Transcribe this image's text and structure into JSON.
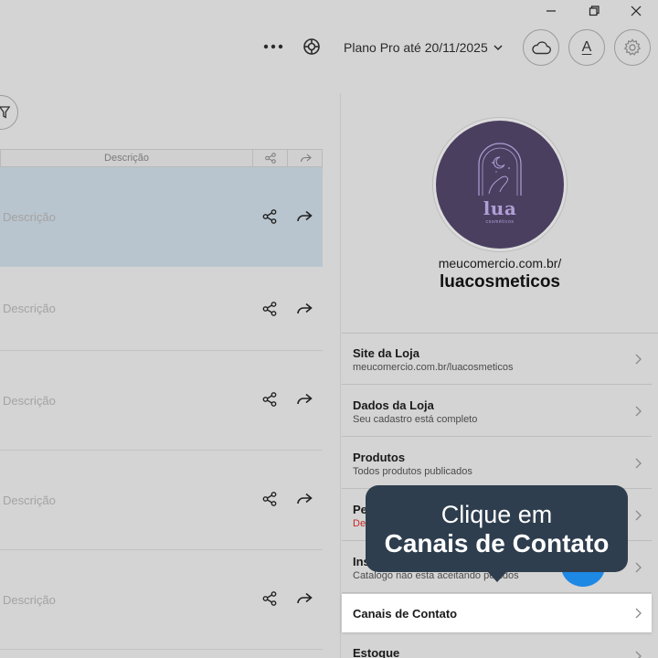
{
  "window": {
    "minimize_icon": "minimize-icon",
    "restore_icon": "restore-icon",
    "close_icon": "close-icon"
  },
  "toolbar": {
    "more_icon": "more-horizontal-icon",
    "help_icon": "lifebuoy-icon",
    "plan_label": "Plano Pro até 20/11/2025",
    "cloud_icon": "cloud-icon",
    "font_label": "A",
    "settings_icon": "gear-icon"
  },
  "table": {
    "filter_icon": "filter-icon",
    "header": {
      "description": "Descrição",
      "share_icon": "share-icon",
      "forward_icon": "forward-icon"
    },
    "rows": [
      {
        "description": "Descrição",
        "selected": true
      },
      {
        "description": "Descrição",
        "selected": false
      },
      {
        "description": "Descrição",
        "selected": false
      },
      {
        "description": "Descrição",
        "selected": false
      },
      {
        "description": "Descrição",
        "selected": false
      }
    ]
  },
  "profile": {
    "logo_text": "lua",
    "logo_subtext": "cosméticos",
    "store_url": "meucomercio.com.br/",
    "store_name": "luacosmeticos"
  },
  "menu": {
    "items": [
      {
        "title": "Site da Loja",
        "subtitle": "meucomercio.com.br/luacosmeticos"
      },
      {
        "title": "Dados da Loja",
        "subtitle": "Seu cadastro está completo"
      },
      {
        "title": "Produtos",
        "subtitle": "Todos produtos publicados"
      },
      {
        "title": "Pe",
        "subtitle": "De",
        "subtitle_color": "#c62828"
      },
      {
        "title": "Ins",
        "subtitle": "Catalogo não esta aceitando pedidos"
      },
      {
        "title": "Canais de Contato",
        "subtitle": "",
        "active": true
      },
      {
        "title": "Estoque",
        "subtitle": ""
      }
    ]
  },
  "tooltip": {
    "line1": "Clique em",
    "line2": "Canais de Contato"
  },
  "colors": {
    "tooltip_bg": "#2e3e4e",
    "fab_blue": "#1e88e5",
    "avatar_bg": "#4b3f60",
    "selected_row": "#b9c5ce",
    "warning_red": "#c62828"
  }
}
